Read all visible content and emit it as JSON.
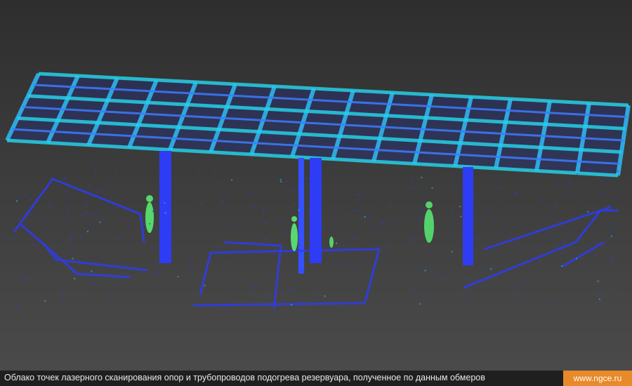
{
  "caption": "Облако точек лазерного сканирования опор и трубопроводов подогрева резервуара, полученное по данным обмеров",
  "site": "www.ngce.ru",
  "colors": {
    "point_blue": "#2a3cff",
    "point_cyan": "#22c6e8",
    "point_green": "#4de07a",
    "badge": "#e8892a"
  }
}
